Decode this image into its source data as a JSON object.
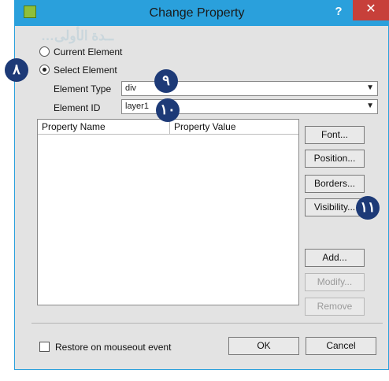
{
  "window": {
    "title": "Change Property",
    "help_label": "?",
    "close_label": "✕",
    "background_text": "…ــدة الأولى"
  },
  "scope": {
    "current_label": "Current Element",
    "select_label": "Select Element",
    "selected": "select"
  },
  "fields": {
    "element_type_label": "Element Type",
    "element_type_value": "div",
    "element_id_label": "Element ID",
    "element_id_value": "layer1"
  },
  "table": {
    "columns": [
      "Property Name",
      "Property Value"
    ],
    "rows": []
  },
  "buttons": {
    "font": "Font...",
    "position": "Position...",
    "borders": "Borders...",
    "visibility": "Visibility...",
    "add": "Add...",
    "modify": "Modify...",
    "remove": "Remove",
    "ok": "OK",
    "cancel": "Cancel"
  },
  "restore": {
    "label": "Restore on mouseout event",
    "checked": false
  },
  "callouts": {
    "scope": "٨",
    "element_type": "٩",
    "element_id": "١٠",
    "visibility": "١١"
  },
  "colors": {
    "titlebar": "#2aa0dc",
    "close": "#c7403a",
    "callout": "#1d3a77"
  }
}
